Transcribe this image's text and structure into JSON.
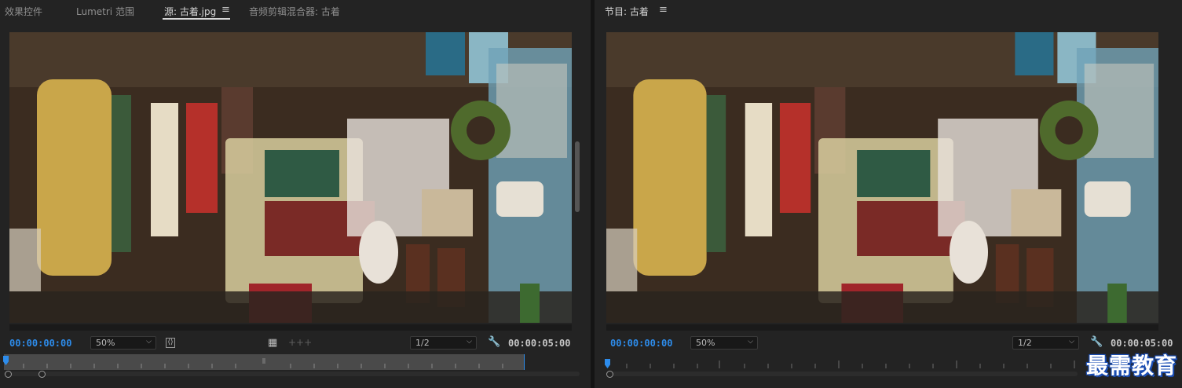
{
  "source": {
    "tabs": [
      {
        "label": "效果控件"
      },
      {
        "label": "Lumetri 范围"
      },
      {
        "label": "源: 古着.jpg",
        "active": true
      },
      {
        "label": "音频剪辑混合器: 古着"
      }
    ],
    "timecode_in": "00:00:00:00",
    "zoom": "50%",
    "resolution": "1/2",
    "timecode_duration": "00:00:05:00"
  },
  "program": {
    "tab": "节目: 古着",
    "timecode_in": "00:00:00:00",
    "zoom": "50%",
    "resolution": "1/2",
    "timecode_duration": "00:00:05:00"
  },
  "watermark": "最需教育",
  "colors": {
    "timecode_blue": "#2d8ceb",
    "panel_bg": "#232323"
  }
}
